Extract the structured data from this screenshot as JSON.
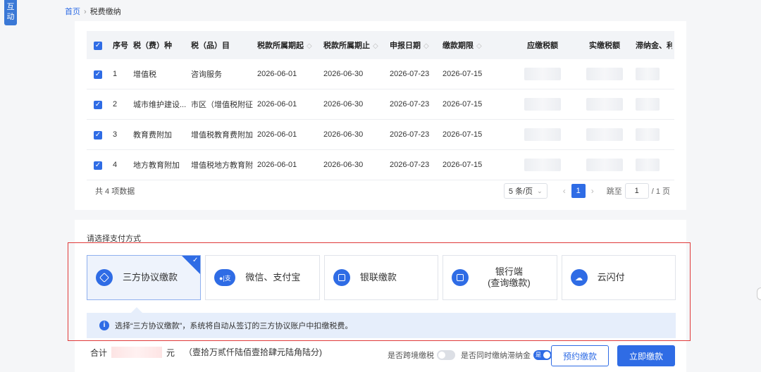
{
  "side_tab": "互动",
  "breadcrumb": {
    "home": "首页",
    "separator": "›",
    "current": "税费缴纳"
  },
  "table": {
    "headers": {
      "no": "序号",
      "type": "税（费）种",
      "item": "税（品）目",
      "start": "税款所属期起",
      "end": "税款所属期止",
      "declare": "申报日期",
      "deadline": "缴款期限",
      "due": "应缴税额",
      "paid": "实缴税额",
      "late": "滞纳金、利..."
    },
    "rows": [
      {
        "no": "1",
        "type": "增值税",
        "item": "咨询服务",
        "start": "2026-06-01",
        "end": "2026-06-30",
        "declare": "2026-07-23",
        "deadline": "2026-07-15"
      },
      {
        "no": "2",
        "type": "城市维护建设...",
        "item": "市区（增值税附征",
        "start": "2026-06-01",
        "end": "2026-06-30",
        "declare": "2026-07-23",
        "deadline": "2026-07-15"
      },
      {
        "no": "3",
        "type": "教育费附加",
        "item": "增值税教育费附加",
        "start": "2026-06-01",
        "end": "2026-06-30",
        "declare": "2026-07-23",
        "deadline": "2026-07-15"
      },
      {
        "no": "4",
        "type": "地方教育附加",
        "item": "增值税地方教育附",
        "start": "2026-06-01",
        "end": "2026-06-30",
        "declare": "2026-07-23",
        "deadline": "2026-07-15"
      }
    ],
    "total_text": "共 4 项数据"
  },
  "pager": {
    "page_size": "5 条/页",
    "current_page": "1",
    "jump_label": "跳至",
    "jump_value": "1",
    "total_pages": "/ 1 页"
  },
  "payment": {
    "title": "请选择支付方式",
    "methods": [
      {
        "label": "三方协议缴款",
        "selected": true
      },
      {
        "label": "微信、支付宝",
        "selected": false
      },
      {
        "label": "银联缴款",
        "selected": false
      },
      {
        "label_line1": "银行端",
        "label_line2": "(查询缴款)",
        "selected": false
      },
      {
        "label": "云闪付",
        "selected": false
      }
    ],
    "notice": "选择“三方协议缴款”，系统将自动从签订的三方协议账户中扣缴税费。"
  },
  "summary": {
    "prefix": "合计",
    "unit": "元",
    "amount_in_words": "（壹拾万贰仟陆佰壹拾肆元陆角陆分)"
  },
  "options": {
    "cross_border_label": "是否跨境缴税",
    "late_fee_label": "是否同时缴纳滞纳金",
    "late_fee_toggle_text": "是",
    "cross_border_on": false,
    "late_fee_on": true
  },
  "buttons": {
    "schedule": "预约缴款",
    "pay_now": "立即缴款"
  },
  "colors": {
    "primary": "#2f6ce5",
    "highlight_frame": "#e03a3a",
    "notice_bg": "#e6eefb"
  }
}
